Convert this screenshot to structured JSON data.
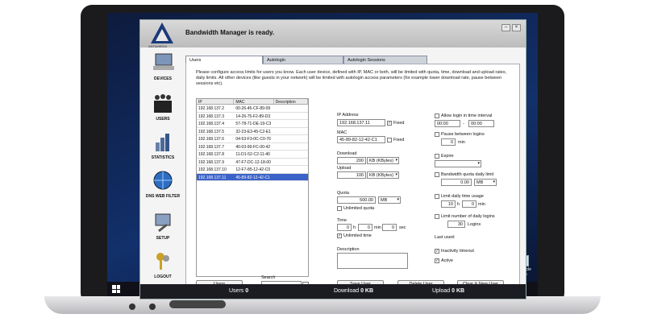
{
  "app": {
    "status_title": "Bandwidth Manager is ready.",
    "logo_text": "ANTAMEDIA"
  },
  "nav": [
    "DEVICES",
    "USERS",
    "STATISTICS",
    "DNS WEB FILTER",
    "SETUP",
    "LOGOUT"
  ],
  "tabs": [
    "Users",
    "Autologin",
    "Autologin Sessions"
  ],
  "intro": "Please configure access limits for users you know. Each user device, defined with IP, MAC or both, will be limited with quota, time, download and upload rates, daily limits. All other devices (like guests in your network) will be limited with autologin access parameters (for example lower download rate, pause between sessions etc).",
  "table": {
    "headers": [
      "IP",
      "MAC",
      "Description"
    ],
    "rows": [
      [
        "192.168.137.2",
        "00-26-45-CF-89-09",
        ""
      ],
      [
        "192.168.137.3",
        "14-26-75-F2-89-D3",
        ""
      ],
      [
        "192.168.137.4",
        "57-78-71-DE-19-C3",
        ""
      ],
      [
        "192.168.137.5",
        "32-23-E3-45-C2-E1",
        ""
      ],
      [
        "192.168.137.6",
        "04-53-F3-0C-C0-76",
        ""
      ],
      [
        "192.168.137.7",
        "40-03-99-FC-00-42",
        ""
      ],
      [
        "192.168.137.8",
        "11-D1-52-C2-11-40",
        ""
      ],
      [
        "192.168.137.9",
        "47-F7-DC-12-18-00",
        ""
      ],
      [
        "192.168.137.10",
        "12-F7-85-12-42-C0",
        ""
      ],
      [
        "192.168.137.11",
        "45-89-82-12-42-C1",
        ""
      ]
    ],
    "selected_index": 9
  },
  "left_buttons": {
    "users": "Users",
    "search_label": "Search"
  },
  "form": {
    "ip_label": "IP Address",
    "ip_value": "192.168.137.11",
    "fixed_label": "Fixed",
    "mac_label": "MAC",
    "mac_value": "45-89-82-12-42-C1",
    "download_label": "Download",
    "download_value": "200",
    "upload_label": "Upload",
    "upload_value": "100",
    "rate_unit": "KB (KBytes)",
    "quota_label": "Quota",
    "quota_value": "500.00",
    "quota_unit": "MB",
    "unlimited_quota": "Unlimited quota",
    "time_label": "Time",
    "time_h": "0",
    "time_min": "0",
    "time_sec": "0",
    "h": "h",
    "min": "min",
    "sec": "sec",
    "unlimited_time": "Unlimited time",
    "description_label": "Description"
  },
  "right": {
    "allow_login": "Allow login in time interval",
    "t1": "00:00",
    "t2": "00:00",
    "dash": "-",
    "pause_label": "Pause between logins",
    "pause_value": "0",
    "min": "min",
    "expire_label": "Expire",
    "quota_daily_label": "Bandwidth quota daily limit",
    "quota_daily_value": "0.00",
    "quota_daily_unit": "MB",
    "limit_time_label": "Limit daily time usage",
    "lt_h": "10",
    "lt_min": "0",
    "h": "h",
    "limit_logins_label": "Limit number of daily logins",
    "logins_value": "30",
    "logins_unit": "Logins",
    "last_used": "Last used:",
    "inactivity": "Inactivity timeout",
    "active": "Active"
  },
  "actions": {
    "save": "Save User",
    "delete": "Delete User",
    "clear": "Clear & New User"
  },
  "statusbar": {
    "users_label": "Users",
    "users_value": "0",
    "download_label": "Download",
    "download_value": "0 KB",
    "upload_label": "Upload",
    "upload_value": "0 KB"
  },
  "desktop": {
    "recycle": "Recycle Bin"
  },
  "colors": {
    "accent": "#3b62c9",
    "titlebar": "#c8c8c8"
  }
}
